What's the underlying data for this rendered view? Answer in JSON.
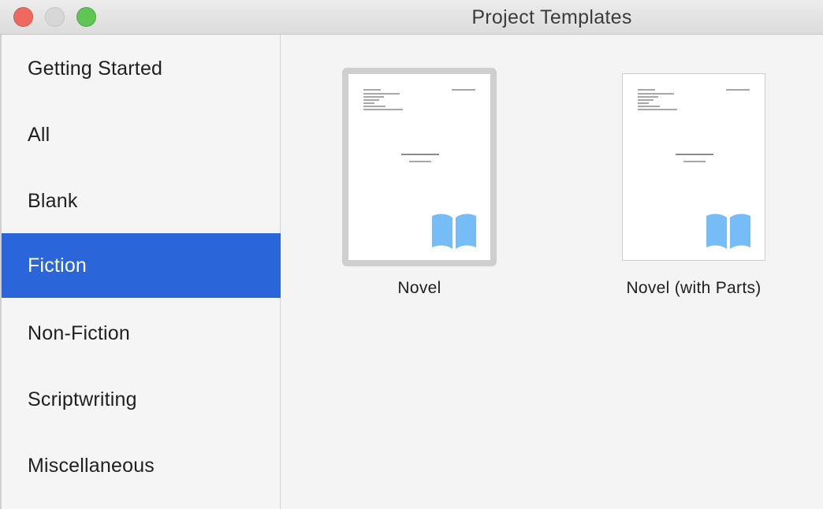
{
  "window": {
    "title": "Project Templates"
  },
  "sidebar": {
    "items": [
      {
        "label": "Getting Started",
        "selected": false
      },
      {
        "label": "All",
        "selected": false
      },
      {
        "label": "Blank",
        "selected": false
      },
      {
        "label": "Fiction",
        "selected": true
      },
      {
        "label": "Non-Fiction",
        "selected": false
      },
      {
        "label": "Scriptwriting",
        "selected": false
      },
      {
        "label": "Miscellaneous",
        "selected": false
      }
    ],
    "selected_color": "#2a65d9"
  },
  "templates": [
    {
      "label": "Novel",
      "selected": true,
      "icon": "book-icon"
    },
    {
      "label": "Novel (with Parts)",
      "selected": false,
      "icon": "book-icon"
    }
  ],
  "colors": {
    "book_icon": "#76bdf8",
    "close": "#ee6a5f",
    "minimize": "#d7d7d7",
    "zoom": "#61c554"
  }
}
